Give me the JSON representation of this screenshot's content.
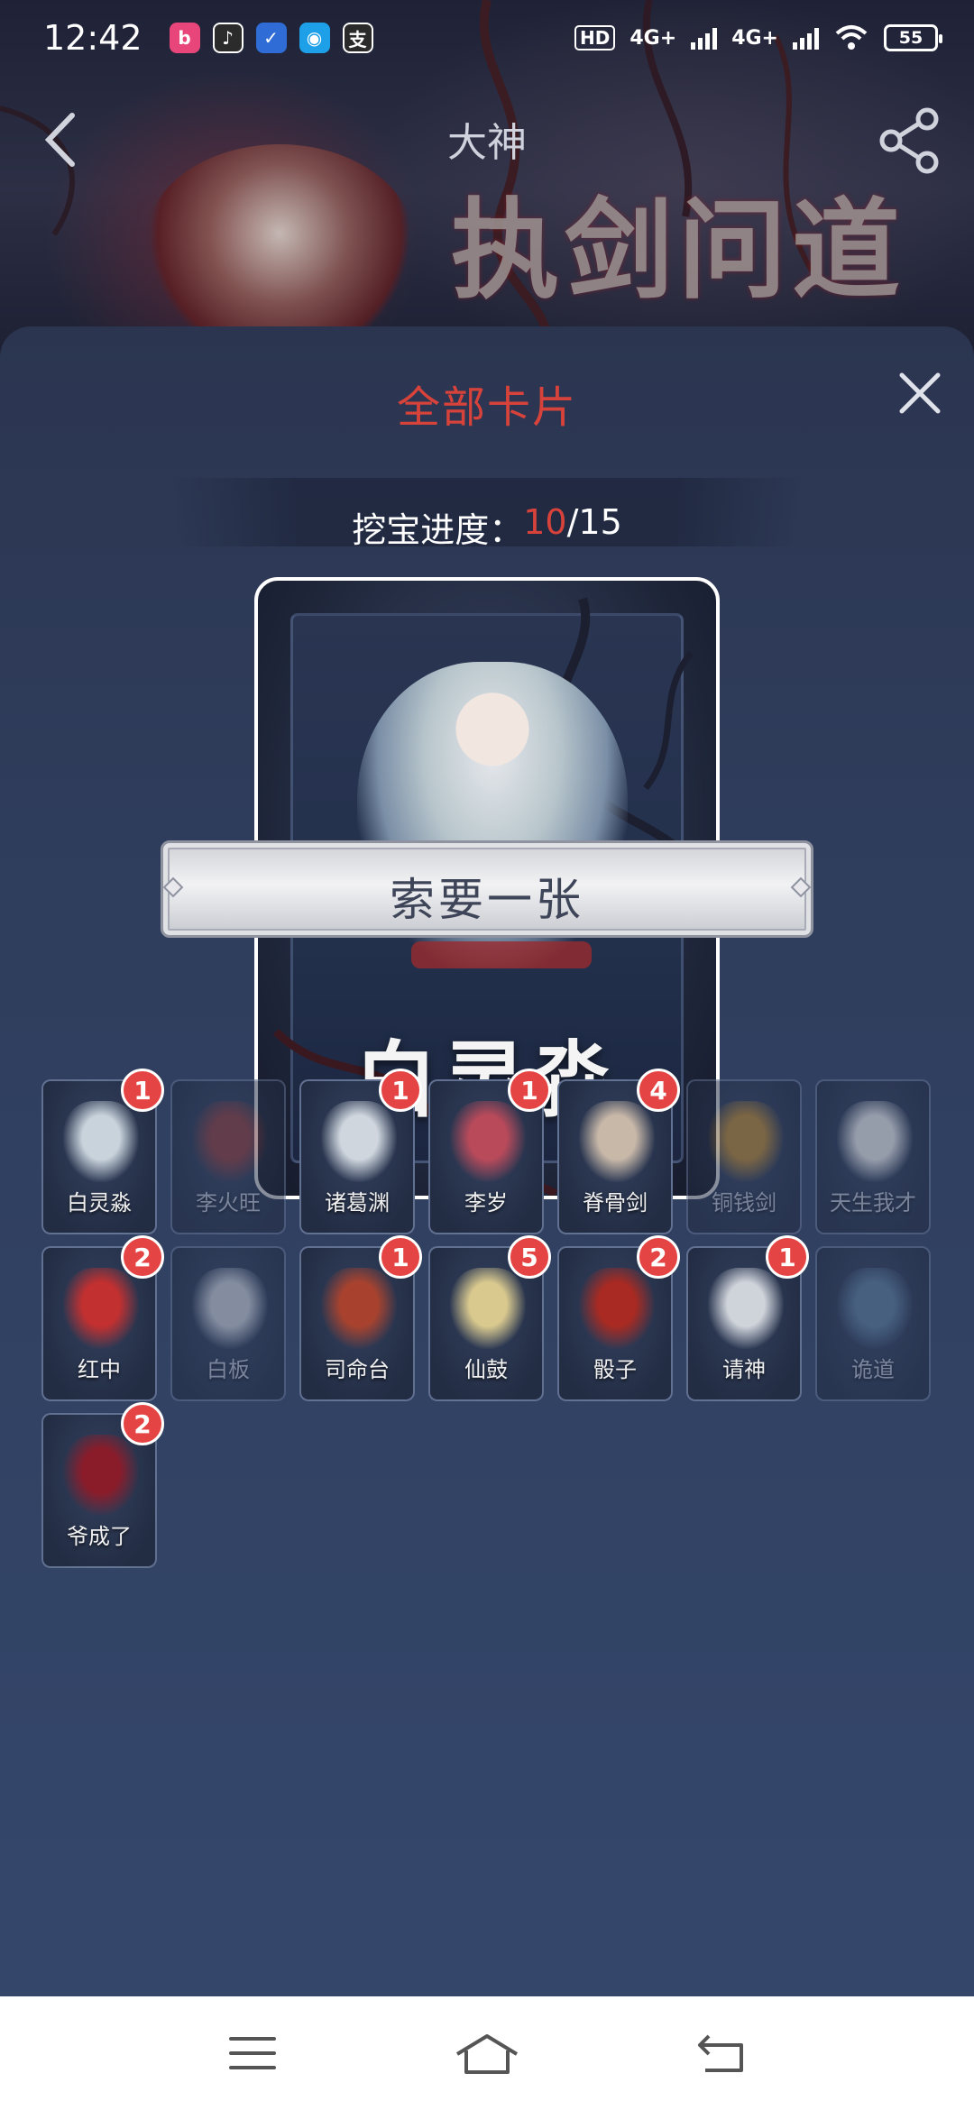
{
  "status_bar": {
    "time": "12:42",
    "battery": "55",
    "network_1": "4G+",
    "network_2": "4G+",
    "hd_label": "HD",
    "apps": [
      "bilibili",
      "music",
      "todo",
      "qq",
      "alipay"
    ]
  },
  "header": {
    "title": "大神",
    "banner_text": "执剑问道"
  },
  "sheet": {
    "title": "全部卡片",
    "progress_label": "挖宝进度：",
    "progress_current": "10",
    "progress_total": "/15",
    "featured_card": {
      "name": "白灵淼"
    },
    "request_button": "索要一张"
  },
  "cards": [
    {
      "name": "白灵淼",
      "count": "1",
      "owned": true,
      "art_color": "#c9d3dc"
    },
    {
      "name": "李火旺",
      "count": "",
      "owned": false,
      "art_color": "#8a3a3a"
    },
    {
      "name": "诸葛渊",
      "count": "1",
      "owned": true,
      "art_color": "#cfd6de"
    },
    {
      "name": "李岁",
      "count": "1",
      "owned": true,
      "art_color": "#b94a5a"
    },
    {
      "name": "脊骨剑",
      "count": "4",
      "owned": true,
      "art_color": "#c8b8a8"
    },
    {
      "name": "铜钱剑",
      "count": "",
      "owned": false,
      "art_color": "#b8852e"
    },
    {
      "name": "天生我才",
      "count": "",
      "owned": false,
      "art_color": "#e8e8e8"
    },
    {
      "name": "红中",
      "count": "2",
      "owned": true,
      "art_color": "#c23030"
    },
    {
      "name": "白板",
      "count": "",
      "owned": false,
      "art_color": "#c8ccd4"
    },
    {
      "name": "司命台",
      "count": "1",
      "owned": true,
      "art_color": "#a8422e"
    },
    {
      "name": "仙鼓",
      "count": "5",
      "owned": true,
      "art_color": "#d9c98e"
    },
    {
      "name": "骰子",
      "count": "2",
      "owned": true,
      "art_color": "#a82a22"
    },
    {
      "name": "请神",
      "count": "1",
      "owned": true,
      "art_color": "#cfd3da"
    },
    {
      "name": "诡道",
      "count": "",
      "owned": false,
      "art_color": "#5a7a9a"
    },
    {
      "name": "爷成了",
      "count": "2",
      "owned": true,
      "art_color": "#8a1c2a"
    }
  ],
  "colors": {
    "accent_red": "#d7433a",
    "badge_red": "#e54444"
  },
  "nav_bar": {
    "icons": [
      "menu-icon",
      "home-icon",
      "back-icon"
    ]
  }
}
